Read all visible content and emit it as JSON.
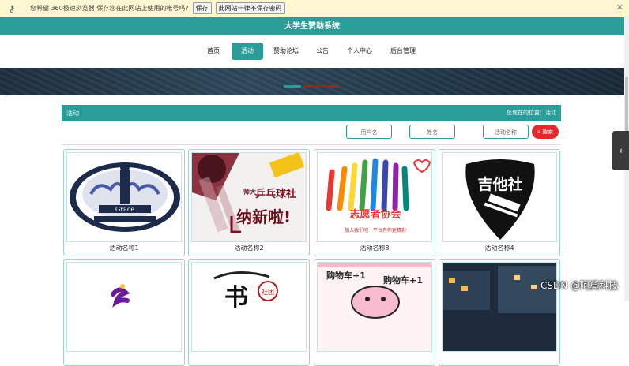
{
  "password_bar": {
    "message": "您希望 360极速浏览器 保存您在此网站上使用的帐号吗?",
    "save_label": "保存",
    "never_label": "此网站一律不保存密码",
    "close_glyph": "✕",
    "key_glyph": "⚷"
  },
  "site": {
    "title": "大学生赞助系统"
  },
  "nav": {
    "items": [
      "首页",
      "活动",
      "赞助论坛",
      "公告",
      "个人中心",
      "后台管理"
    ],
    "active": "活动"
  },
  "section": {
    "title": "活动",
    "breadcrumb": "您现在的位置：活动"
  },
  "search": {
    "field1_placeholder": "用户名",
    "field2_placeholder": "姓名",
    "field3_placeholder": "活动名称",
    "button_label": "搜索",
    "button_icon": "search-icon"
  },
  "cards": [
    {
      "caption": "活动名称1",
      "image": "grace-logo"
    },
    {
      "caption": "活动名称2",
      "image": "ping-pong-club-poster",
      "text_a": "乒乓球社",
      "text_b": "纳新啦!",
      "text_c": "师大"
    },
    {
      "caption": "活动名称3",
      "image": "volunteer-hands",
      "text_a": "志愿者协会",
      "text_b": "加入我们吧 · 平台有你更精彩"
    },
    {
      "caption": "活动名称4",
      "image": "guitar-club-logo",
      "text_a": "吉他社"
    },
    {
      "caption": "",
      "image": "partial-logo"
    },
    {
      "caption": "",
      "image": "calligraphy-club",
      "text_a": "书",
      "text_b": "社团"
    },
    {
      "caption": "",
      "image": "shopping-cart-poster",
      "text_a": "购物车+1",
      "text_b": "购物车+1"
    },
    {
      "caption": "",
      "image": "night-street"
    }
  ],
  "side_tab": {
    "glyph": "‹"
  },
  "watermark": "CSDN @阿莫科技",
  "colors": {
    "accent": "#2a9d98",
    "search_button": "#e8282d",
    "password_bar": "#fff7d1"
  }
}
